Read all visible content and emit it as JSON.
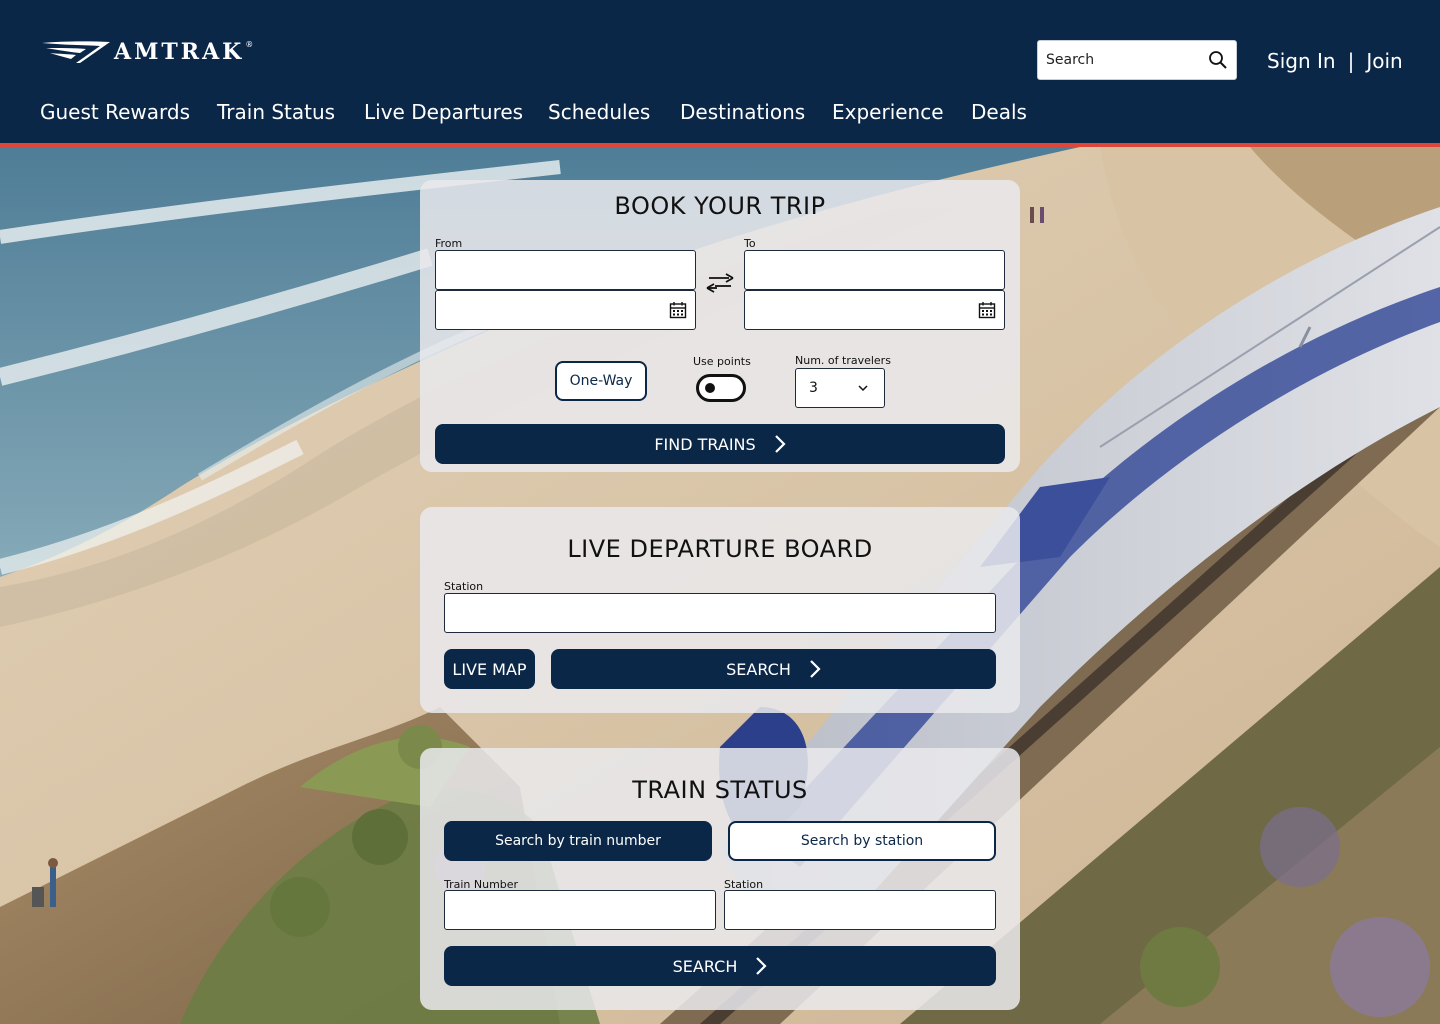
{
  "brand": {
    "name": "AMTRAK",
    "reg": "®"
  },
  "colors": {
    "navy": "#0b2748",
    "accent_red": "#e0453a",
    "card_bg": "#e9e9ec"
  },
  "header": {
    "search": {
      "placeholder": "Search",
      "icon": "search-icon"
    },
    "auth": {
      "sign_in": "Sign In",
      "separator": "|",
      "join": "Join"
    },
    "nav": [
      "Guest Rewards",
      "Train Status",
      "Live Departures",
      "Schedules",
      "Destinations",
      "Experience",
      "Deals"
    ]
  },
  "book_trip": {
    "title": "BOOK YOUR TRIP",
    "from_label": "From",
    "to_label": "To",
    "swap_icon": "swap-arrows-icon",
    "calendar_icon": "calendar-icon",
    "trip_type": "One-Way",
    "use_points_label": "Use points",
    "use_points_on": false,
    "travelers_label": "Num. of travelers",
    "travelers_value": "3",
    "find_button": "FIND TRAINS"
  },
  "departure_board": {
    "title": "LIVE DEPARTURE BOARD",
    "station_label": "Station",
    "live_map_button": "LIVE MAP",
    "search_button": "SEARCH"
  },
  "train_status": {
    "title": "TRAIN STATUS",
    "tab_train_number": "Search by train number",
    "tab_station": "Search by station",
    "train_number_label": "Train Number",
    "station_label": "Station",
    "search_button": "SEARCH"
  }
}
